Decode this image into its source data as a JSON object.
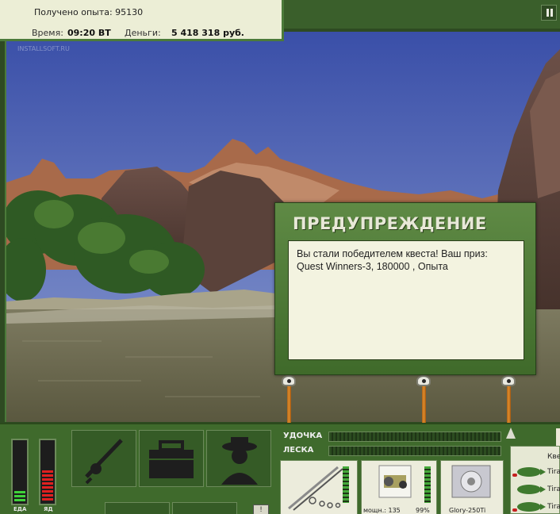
{
  "info": {
    "experience_text": "Получено опыта: 95130",
    "time_label": "Время:",
    "time_value": "09:20 ВТ",
    "money_label": "Деньги:",
    "money_value": "5 418 318 руб."
  },
  "watermark": "INSTALLSOFT.RU",
  "dialog": {
    "title": "ПРЕДУПРЕЖДЕНИЕ",
    "message": "Вы стали победителем квеста! Ваш приз: Quest Winners-3, 180000 , Опыта"
  },
  "gauges": {
    "food_label": "ЕДА",
    "food_level": 0.18,
    "food_color": "#3fd23a",
    "poison_label": "ЯД",
    "poison_level": 0.5,
    "poison_color": "#e02020"
  },
  "bars": {
    "rod_label": "УДОЧКА",
    "line_label": "ЛЕСКА"
  },
  "slots": {
    "reel_power_text": "мощн.: 135",
    "reel_percent": "99%",
    "lure_name": "Glory-250Ti"
  },
  "quest": {
    "title": "Кве",
    "items": [
      "Tira",
      "Tira",
      "Tira"
    ]
  },
  "small_button": "!",
  "colors": {
    "panel_green": "#3f6a2c",
    "info_bg": "#eceed6",
    "dialog_green": "#4f7a38"
  }
}
